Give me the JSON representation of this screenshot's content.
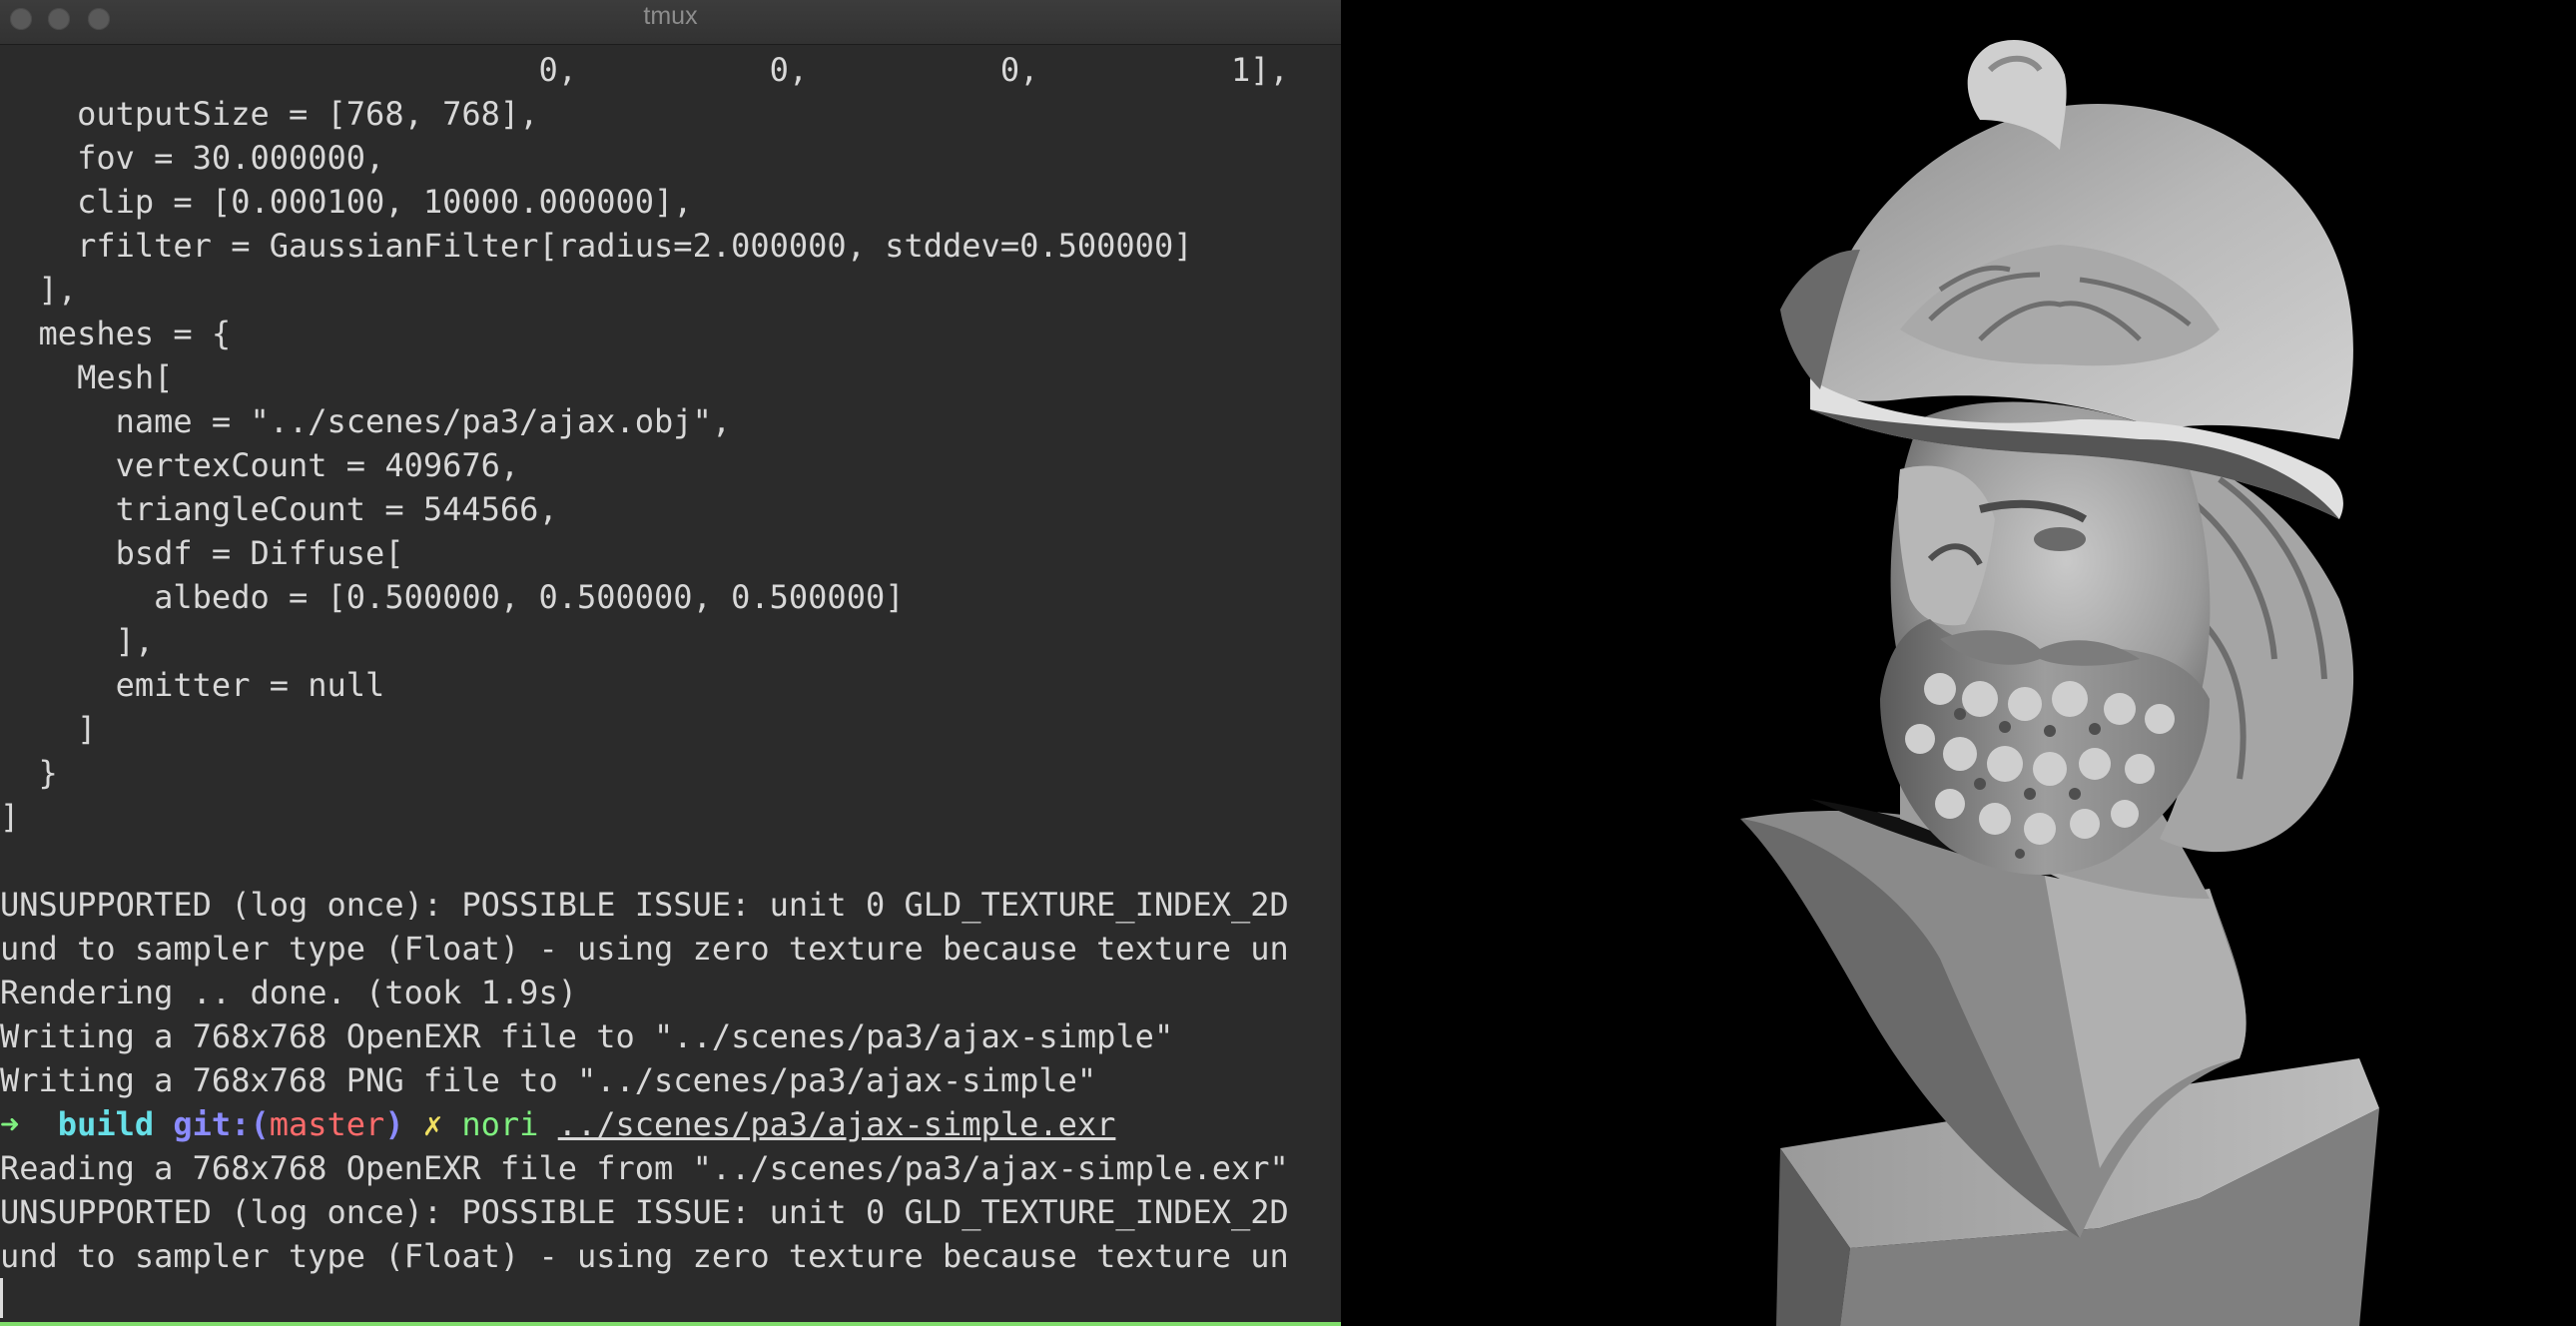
{
  "window": {
    "title": "tmux"
  },
  "terminal": {
    "lines": [
      "                            0,          0,          0,          1],",
      "    outputSize = [768, 768],",
      "    fov = 30.000000,",
      "    clip = [0.000100, 10000.000000],",
      "    rfilter = GaussianFilter[radius=2.000000, stddev=0.500000]",
      "  ],",
      "  meshes = {",
      "    Mesh[",
      "      name = \"../scenes/pa3/ajax.obj\",",
      "      vertexCount = 409676,",
      "      triangleCount = 544566,",
      "      bsdf = Diffuse[",
      "        albedo = [0.500000, 0.500000, 0.500000]",
      "      ],",
      "      emitter = null",
      "    ]",
      "  }",
      "]",
      "",
      "UNSUPPORTED (log once): POSSIBLE ISSUE: unit 0 GLD_TEXTURE_INDEX_2D",
      "und to sampler type (Float) - using zero texture because texture un",
      "Rendering .. done. (took 1.9s)",
      "Writing a 768x768 OpenEXR file to \"../scenes/pa3/ajax-simple\"",
      "Writing a 768x768 PNG file to \"../scenes/pa3/ajax-simple\""
    ],
    "prompt": {
      "arrow": "➜",
      "dir": "build",
      "git_label": "git:(",
      "branch": "master",
      "git_close": ")",
      "dirty_mark": "✗",
      "command": "nori",
      "argument": "../scenes/pa3/ajax-simple.exr"
    },
    "after_lines": [
      "Reading a 768x768 OpenEXR file from \"../scenes/pa3/ajax-simple.exr\"",
      "UNSUPPORTED (log once): POSSIBLE ISSUE: unit 0 GLD_TEXTURE_INDEX_2D",
      "und to sampler type (Float) - using zero texture because texture un"
    ]
  },
  "colors": {
    "terminal_bg": "#2b2b2b",
    "prompt_arrow": "#7ff07f",
    "prompt_dir": "#67e0e8",
    "git_label": "#8b8bff",
    "git_branch": "#ff6b6b",
    "dirty_mark": "#f0e062",
    "status_strip": "#7fdc6a"
  },
  "viewer": {
    "image": "rendered-ajax-bust"
  }
}
